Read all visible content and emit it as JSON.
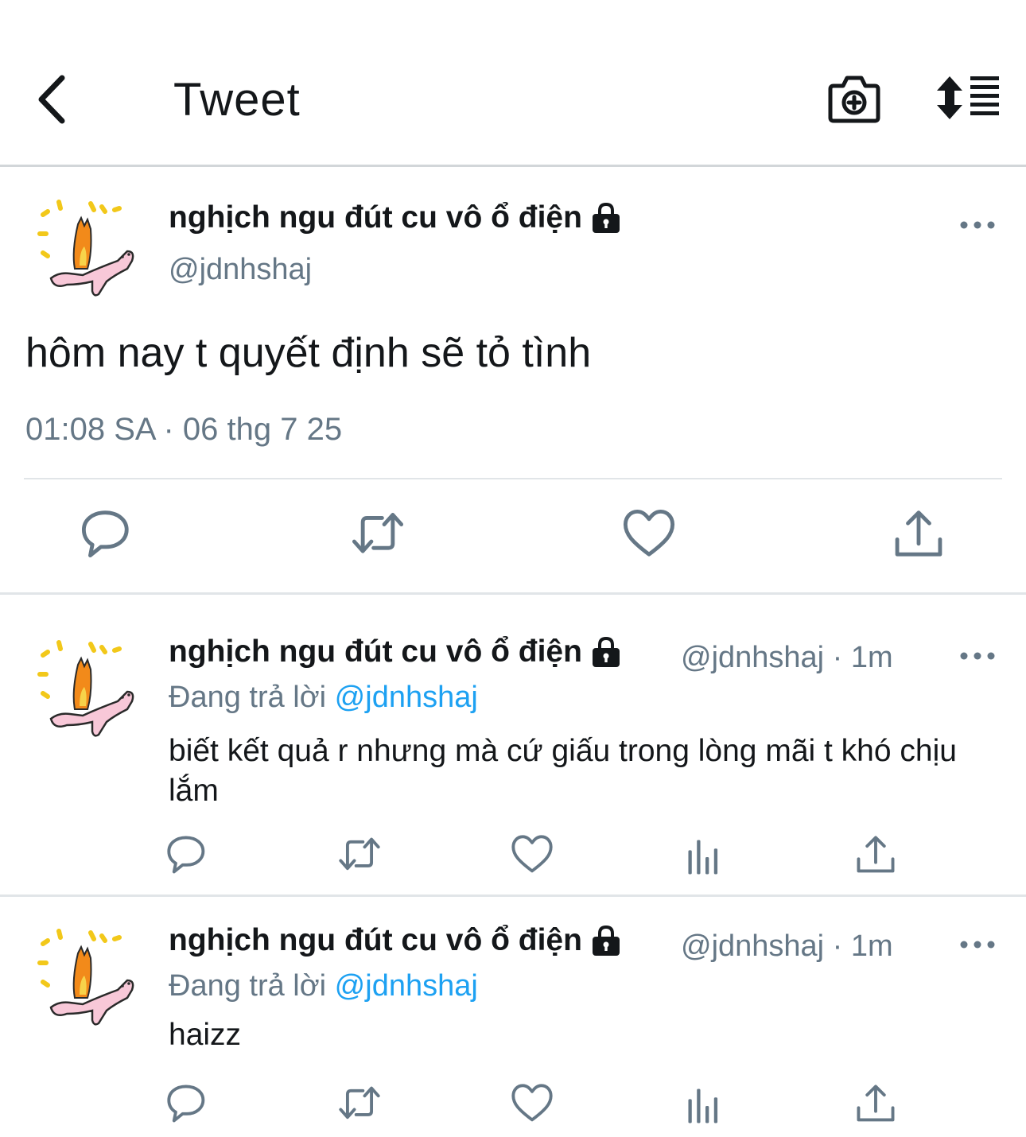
{
  "header": {
    "title": "Tweet",
    "icons": [
      "back-arrow-icon",
      "camera-plus-icon",
      "sort-toggle-icon"
    ]
  },
  "main_tweet": {
    "display_name": "nghịch ngu đút cu vô ổ điện",
    "handle": "@jdnhshaj",
    "text": "hôm nay t quyết định sẽ tỏ tình",
    "timestamp": "01:08 SA · 06 thg 7 25",
    "actions": [
      "reply-icon",
      "retweet-icon",
      "like-icon",
      "share-icon"
    ]
  },
  "replies": [
    {
      "display_name": "nghịch ngu đút cu vô ổ điện",
      "meta": "@jdnhshaj · 1m",
      "replying_prefix": "Đang trả lời",
      "replying_to": "@jdnhshaj",
      "text": "biết kết quả r nhưng mà cứ giấu trong lòng mãi t khó chịu lắm"
    },
    {
      "display_name": "nghịch ngu đút cu vô ổ điện",
      "meta": "@jdnhshaj · 1m",
      "replying_prefix": "Đang trả lời",
      "replying_to": "@jdnhshaj",
      "text": "haizz"
    }
  ],
  "colors": {
    "text": "#14171a",
    "secondary": "#657786",
    "link": "#1da1f2",
    "divider": "#e1e5e8",
    "icon": "#657786"
  }
}
